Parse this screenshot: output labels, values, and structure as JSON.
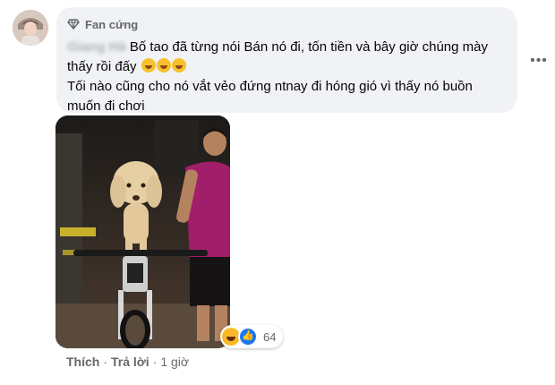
{
  "comment": {
    "badge_label": "Fan cứng",
    "author_name": "Giang Hà",
    "line1": "Bố tao đã từng nói Bán nó đi, tốn tiền và bây giờ chúng mày thấy rồi đấy",
    "emojis": [
      "rolling-laughing-emoji",
      "rolling-laughing-emoji",
      "rolling-laughing-emoji"
    ],
    "line2": "Tối nào cũng cho nó vắt vẻo đứng ntnay đi hóng gió vì thấy nó buồn muốn đi chơi",
    "more_label": "•••"
  },
  "reactions": {
    "icons": [
      "haha-icon",
      "like-icon"
    ],
    "count": "64"
  },
  "actions": {
    "like_label": "Thích",
    "separator": "·",
    "reply_label": "Trả lời",
    "time": "1 giờ"
  },
  "colors": {
    "bubble_bg": "#f0f2f5",
    "muted_text": "#65676b",
    "like_blue": "#1877f2",
    "haha_yellow": "#f7b928"
  }
}
